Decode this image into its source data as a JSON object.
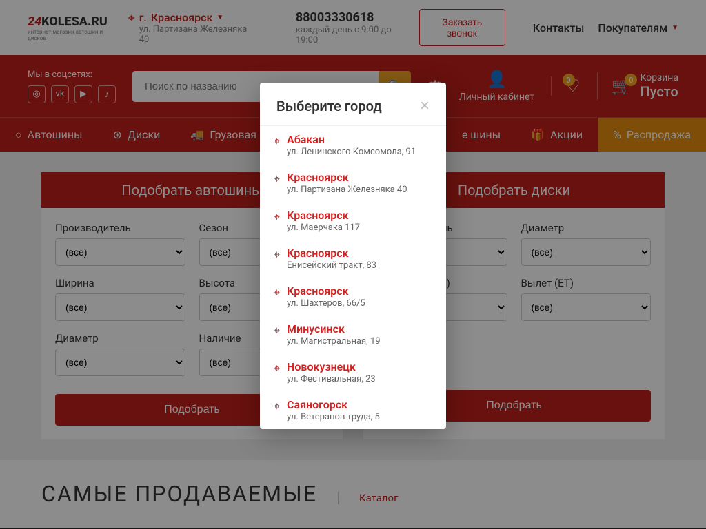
{
  "header": {
    "logo_main_red": "24",
    "logo_main_rest": "KOLESA.RU",
    "logo_sub": "интернет-магазин автошин и дисков",
    "city_prefix": "г.",
    "city": "Красноярск",
    "address": "ул. Партизана Железняка 40",
    "phone": "88003330618",
    "hours": "каждый день с 9:00 до 19:00",
    "callback": "Заказать звонок",
    "contacts": "Контакты",
    "buyers": "Покупателям"
  },
  "redbar": {
    "social_label": "Мы в соцсетях:",
    "search_placeholder": "Поиск по названию",
    "account": "Личный кабинет",
    "fav_badge": "0",
    "cart_badge": "0",
    "cart_label": "Корзина",
    "cart_value": "Пусто"
  },
  "nav": {
    "items": [
      "Автошины",
      "Диски",
      "Грузовая",
      "е шины",
      "Акции",
      "Распродажа"
    ]
  },
  "panels": {
    "tires": {
      "title": "Подобрать автошины",
      "fields": [
        "Производитель",
        "Сезон",
        "Ширина",
        "Высота",
        "Диаметр",
        "Наличие"
      ],
      "all": "(все)",
      "button": "Подобрать"
    },
    "disks": {
      "title": "Подобрать диски",
      "fields": [
        "Производитель",
        "Диаметр",
        "Диаметр (PCD)",
        "Вылет (ET)"
      ],
      "all": "(все)",
      "button": "Подобрать"
    }
  },
  "bottom": {
    "heading": "САМЫЕ ПРОДАВАЕМЫЕ",
    "catalog": "Каталог"
  },
  "modal": {
    "title": "Выберите город",
    "cities": [
      {
        "name": "Абакан",
        "addr": "ул. Ленинского Комсомола, 91"
      },
      {
        "name": "Красноярск",
        "addr": "ул. Партизана Железняка 40"
      },
      {
        "name": "Красноярск",
        "addr": "ул. Маерчака 117"
      },
      {
        "name": "Красноярск",
        "addr": "Енисейский тракт, 83"
      },
      {
        "name": "Красноярск",
        "addr": "ул. Шахтеров, 66/5"
      },
      {
        "name": "Минусинск",
        "addr": "ул. Магистральная, 19"
      },
      {
        "name": "Новокузнецк",
        "addr": "ул. Фестивальная, 23"
      },
      {
        "name": "Саяногорск",
        "addr": "ул. Ветеранов труда, 5"
      }
    ]
  }
}
